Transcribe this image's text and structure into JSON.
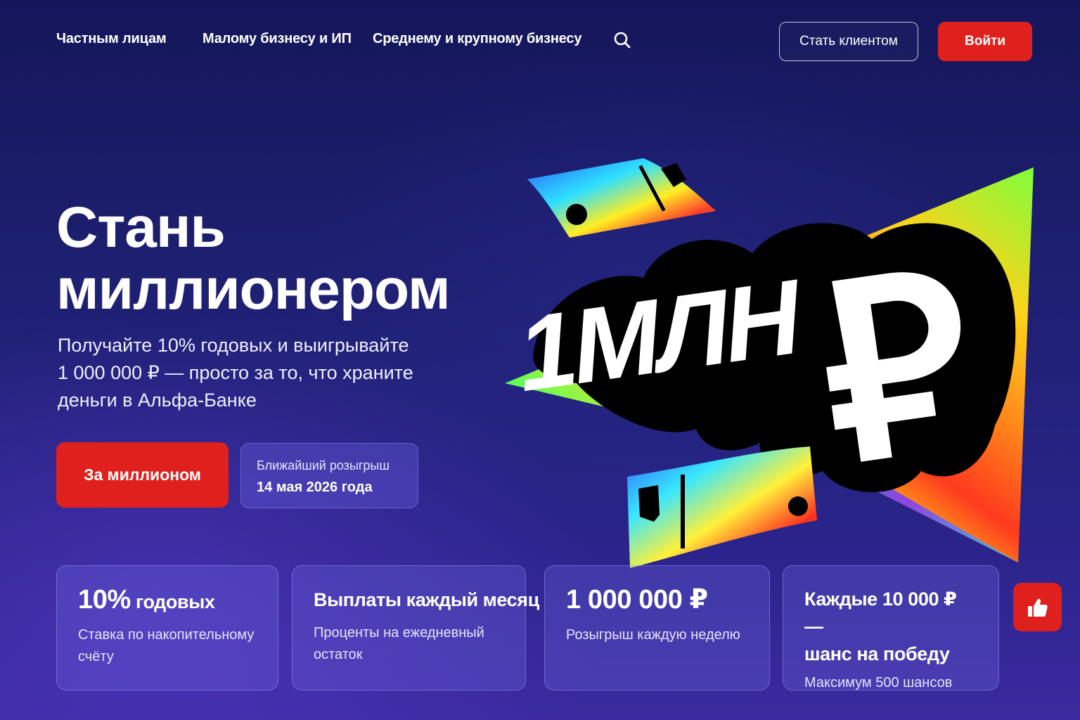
{
  "nav": {
    "links": [
      "Частным лицам",
      "Малому бизнесу и ИП",
      "Среднему и крупному бизнесу"
    ],
    "client_label": "Стать клиентом",
    "login_label": "Войти"
  },
  "hero": {
    "title_line1": "Стань",
    "title_line2": "миллионером",
    "subtitle_line1": "Получайте 10% годовых и выигрывайте",
    "subtitle_line2": "1 000 000 ₽ — просто за то, что храните",
    "subtitle_line3": "деньги в Альфа-Банке",
    "cta_label": "За миллионом",
    "draw_label": "Ближайший розыгрыш",
    "draw_date": "14 мая 2026 года",
    "art_text": "1МЛН ₽"
  },
  "cards": [
    {
      "title_big": "10%",
      "title_rest": " годовых",
      "desc_line1": "Ставка по накопительному",
      "desc_line2": "счёту"
    },
    {
      "title": "Выплаты каждый месяц",
      "desc_line1": "Проценты на ежедневный",
      "desc_line2": "остаток"
    },
    {
      "title": "1 000 000 ₽",
      "desc_line1": "Розыгрыш каждую неделю"
    },
    {
      "title_line1": "Каждые 10 000 ₽ —",
      "title_line2": "шанс на победу",
      "desc_line1": "Максимум 500 шансов"
    }
  ],
  "icons": {
    "search": "search-icon",
    "like": "thumbs-up-icon"
  },
  "colors": {
    "accent": "#e0201c",
    "background": "#1e2072"
  }
}
